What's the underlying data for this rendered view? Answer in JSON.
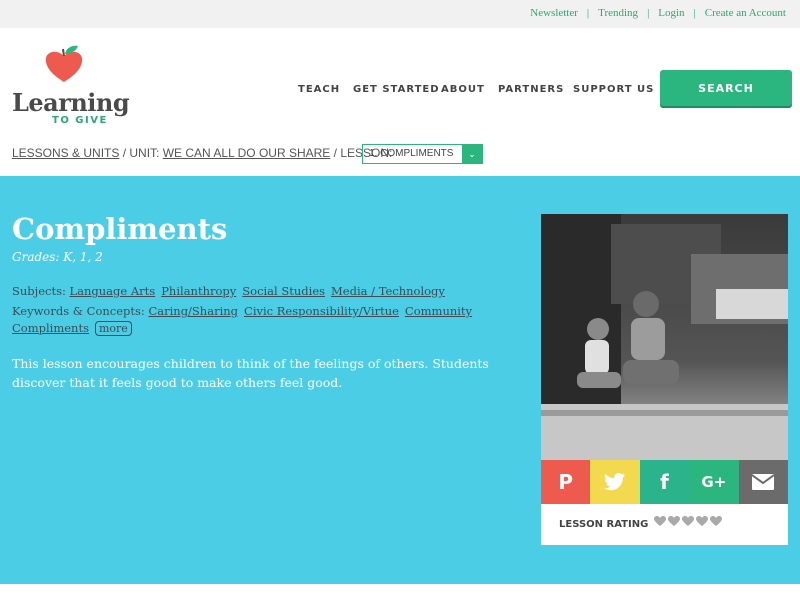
{
  "topbar": {
    "links": [
      "Newsletter",
      "Trending",
      "Login",
      "Create an Account"
    ],
    "separator": "|"
  },
  "logo": {
    "word": "Learning",
    "sub": "TO GIVE"
  },
  "nav": [
    "TEACH",
    "GET STARTED",
    "ABOUT",
    "PARTNERS",
    "SUPPORT US"
  ],
  "search_label": "SEARCH",
  "breadcrumb": {
    "lessons_units": "LESSONS & UNITS",
    "sep1": " / UNIT: ",
    "unit": "WE CAN ALL DO OUR SHARE",
    "sep2": " / LESSON:",
    "lesson_selected": "1. COMPLIMENTS",
    "dropdown_arrow": "⌄"
  },
  "lesson": {
    "title": "Compliments",
    "grades": "Grades: K, 1, 2",
    "subjects_label": "Subjects:",
    "subjects": [
      "Language Arts",
      "Philanthropy",
      "Social Studies",
      "Media / Technology"
    ],
    "keywords_label": "Keywords & Concepts:",
    "keywords_line1": [
      "Caring/Sharing",
      "Civic Responsibility/Virtue",
      "Community"
    ],
    "keywords_line2": [
      "Compliments"
    ],
    "more_label": "more",
    "description": "This lesson encourages children to think of the feelings of others. Students discover that it feels good to make others feel good."
  },
  "share": {
    "icons": [
      "pinterest-icon",
      "twitter-icon",
      "facebook-icon",
      "google-plus-icon",
      "email-icon"
    ],
    "colors": [
      "#ef5a4e",
      "#f2d94e",
      "#2bb48c",
      "#2bb57f",
      "#6b6b6b"
    ],
    "glyphs": [
      "P",
      "",
      "f",
      "G+",
      ""
    ]
  },
  "rating": {
    "label": "LESSON RATING",
    "max": 5,
    "value": 0
  },
  "colors": {
    "accent": "#2bb57f",
    "band": "#4bcde6",
    "topbar": "#f1f1f1"
  }
}
